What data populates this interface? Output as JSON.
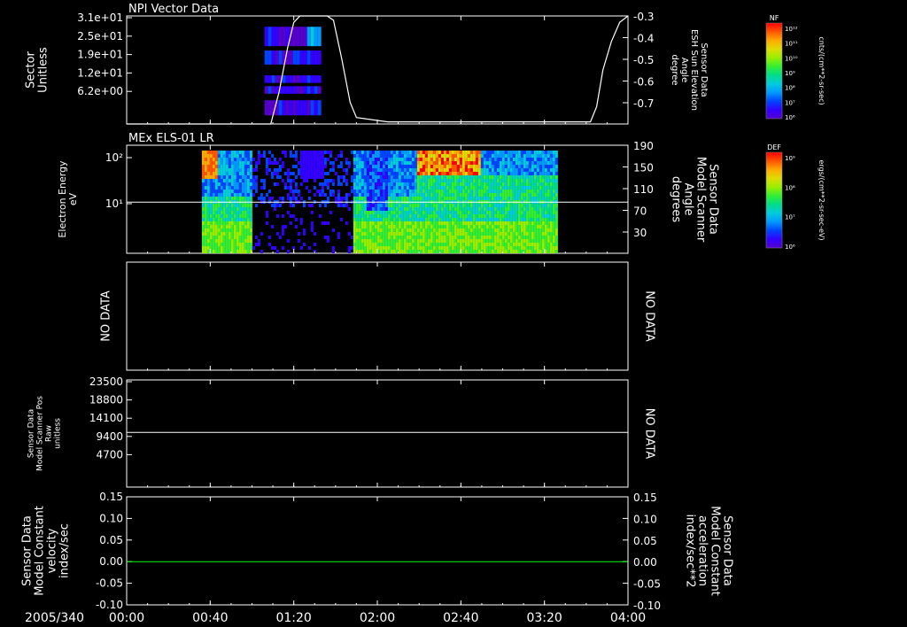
{
  "colors": {
    "background": "#000000",
    "frame": "#ffffff",
    "accent": "#00ff00"
  },
  "date_label": "2005/340",
  "x_ticks": [
    "00:00",
    "00:40",
    "01:20",
    "02:00",
    "02:40",
    "03:20",
    "04:00"
  ],
  "x_range_minutes": [
    0,
    240
  ],
  "chart_data": [
    {
      "type": "heatmap",
      "title": "NPI Vector Data",
      "ylabel": "Sector\nUnitless",
      "yticks": [
        "3.1e+01",
        "2.5e+01",
        "1.9e+01",
        "1.2e+01",
        "6.2e+00"
      ],
      "ylim": [
        0,
        31
      ],
      "right_ylabel": "Sensor Data\nESH Sun Elevation\nAngle\ndegree",
      "right_yticks": [
        "-0.3",
        "-0.4",
        "-0.5",
        "-0.6",
        "-0.7"
      ],
      "right_ylim": [
        -0.8,
        -0.3
      ],
      "colorbar": {
        "title": "NF",
        "units": "cnts/(cm**2-sr-sec)",
        "ticks": [
          "10¹²",
          "10¹¹",
          "10¹⁰",
          "10⁹",
          "10⁸",
          "10⁷",
          "10⁶"
        ]
      },
      "heatmap_span_minutes": [
        66,
        93
      ],
      "line": {
        "x_minutes": [
          0,
          69,
          73,
          77,
          80,
          83,
          96,
          99,
          103,
          107,
          110,
          125,
          222,
          225,
          228,
          232,
          236,
          240
        ],
        "y": [
          -0.8,
          -0.8,
          -0.65,
          -0.45,
          -0.33,
          -0.3,
          -0.3,
          -0.32,
          -0.5,
          -0.7,
          -0.77,
          -0.79,
          -0.79,
          -0.72,
          -0.55,
          -0.42,
          -0.33,
          -0.3
        ]
      }
    },
    {
      "type": "heatmap",
      "title": "MEx ELS-01 LR",
      "ylabel": "Electron Energy\neV",
      "yticks": [
        "10²",
        "10¹"
      ],
      "right_ylabel": "Sensor Data\nModel Scanner\nAngle\ndegrees",
      "right_yticks": [
        "190",
        "150",
        "110",
        "70",
        "30"
      ],
      "right_ylim": [
        0,
        190
      ],
      "colorbar": {
        "title": "DEF",
        "units": "ergs/(cm**2-sr-sec-eV)",
        "ticks": [
          "10⁹",
          "10⁸",
          "10⁷",
          "10⁶"
        ]
      },
      "heatmap_span_minutes": [
        36,
        206
      ],
      "line": {
        "constant_right": 90
      }
    },
    {
      "type": "line",
      "ylabel": "NO DATA",
      "right_ylabel": "NO DATA"
    },
    {
      "type": "line",
      "ylabel": "Sensor Data\nModel Scanner Pos\nRaw\nunitless",
      "yticks": [
        "23500",
        "18800",
        "14100",
        "9400",
        "4700"
      ],
      "ylim": [
        0,
        23500
      ],
      "right_ylabel": "NO DATA",
      "line": {
        "constant": 12000
      }
    },
    {
      "type": "line",
      "ylabel": "Sensor Data\nModel Constant\nvelocity\nindex/sec",
      "yticks": [
        "0.15",
        "0.10",
        "0.05",
        "0.00",
        "-0.05",
        "-0.10"
      ],
      "ylim": [
        -0.1,
        0.15
      ],
      "right_ylabel": "Sensor Data\nModel Constant\nacceleration\nindex/sec**2",
      "right_yticks": [
        "0.15",
        "0.10",
        "0.05",
        "0.00",
        "-0.05",
        "-0.10"
      ],
      "line": {
        "constant": 0.0
      }
    }
  ]
}
